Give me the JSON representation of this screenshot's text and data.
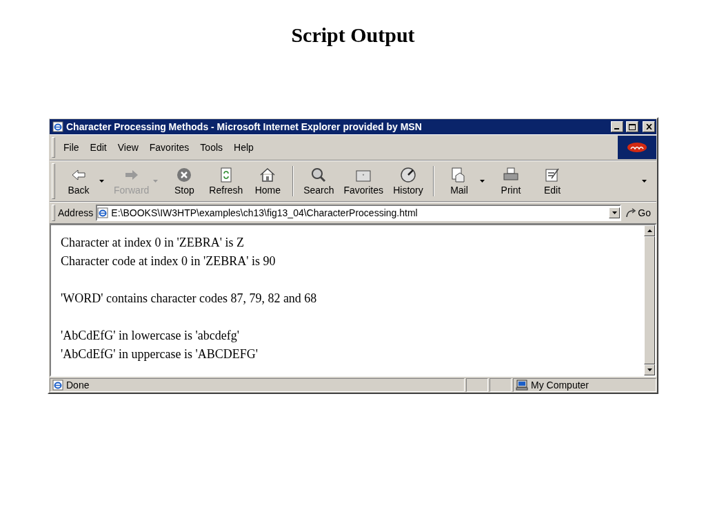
{
  "slide_title": "Script Output",
  "window": {
    "title": "Character Processing Methods - Microsoft Internet Explorer provided by MSN"
  },
  "menu": [
    {
      "label": "File"
    },
    {
      "label": "Edit"
    },
    {
      "label": "View"
    },
    {
      "label": "Favorites"
    },
    {
      "label": "Tools"
    },
    {
      "label": "Help"
    }
  ],
  "toolbar": [
    {
      "kind": "back",
      "label": "Back",
      "disabled": false,
      "has_menu": true
    },
    {
      "kind": "forward",
      "label": "Forward",
      "disabled": true,
      "has_menu": true
    },
    {
      "kind": "stop",
      "label": "Stop",
      "disabled": false,
      "has_menu": false
    },
    {
      "kind": "refresh",
      "label": "Refresh",
      "disabled": false,
      "has_menu": false
    },
    {
      "kind": "home",
      "label": "Home",
      "disabled": false,
      "has_menu": false
    },
    {
      "kind": "separator"
    },
    {
      "kind": "search",
      "label": "Search",
      "disabled": false,
      "has_menu": false
    },
    {
      "kind": "favorites",
      "label": "Favorites",
      "disabled": false,
      "has_menu": false
    },
    {
      "kind": "history",
      "label": "History",
      "disabled": false,
      "has_menu": false
    },
    {
      "kind": "separator"
    },
    {
      "kind": "mail",
      "label": "Mail",
      "disabled": false,
      "has_menu": true
    },
    {
      "kind": "print",
      "label": "Print",
      "disabled": false,
      "has_menu": false
    },
    {
      "kind": "edit",
      "label": "Edit",
      "disabled": false,
      "has_menu": false
    }
  ],
  "address": {
    "label": "Address",
    "value": "E:\\BOOKS\\IW3HTP\\examples\\ch13\\fig13_04\\CharacterProcessing.html",
    "go": "Go"
  },
  "content": {
    "paragraphs": [
      [
        "Character at index 0 in 'ZEBRA' is Z",
        "Character code at index 0 in 'ZEBRA' is 90"
      ],
      [
        "'WORD' contains character codes 87, 79, 82 and 68"
      ],
      [
        "'AbCdEfG' in lowercase is 'abcdefg'",
        "'AbCdEfG' in uppercase is 'ABCDEFG'"
      ]
    ]
  },
  "status_bar": {
    "text": "Done",
    "zone": "My Computer"
  }
}
